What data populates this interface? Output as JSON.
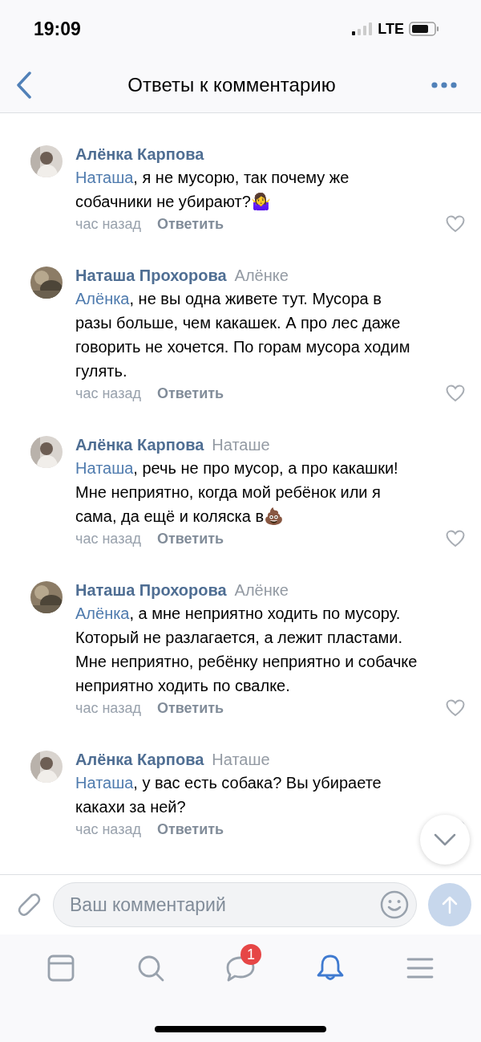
{
  "status_bar": {
    "time": "19:09",
    "network": "LTE"
  },
  "header": {
    "title": "Ответы к комментарию"
  },
  "comments": [
    {
      "author": "Алёнка Карпова",
      "mention": "Наташа",
      "text": ", я не мусорю, так почему же собачники не убирают?",
      "emoji": "🤷‍♀️",
      "time": "час назад",
      "reply": "Ответить"
    },
    {
      "author": "Наташа Прохорова",
      "reply_to": "Алёнке",
      "mention": "Алёнка",
      "text": ", не вы одна живете тут. Мусора в разы больше, чем какашек. А про лес даже говорить не хочется. По горам мусора ходим гулять.",
      "time": "час назад",
      "reply": "Ответить"
    },
    {
      "author": "Алёнка Карпова",
      "reply_to": "Наташе",
      "mention": "Наташа",
      "text": ", речь не про мусор, а про какашки! Мне неприятно,  когда мой ребёнок или я сама, да ещё и коляска в",
      "emoji": "💩",
      "time": "час назад",
      "reply": "Ответить"
    },
    {
      "author": "Наташа Прохорова",
      "reply_to": "Алёнке",
      "mention": "Алёнка",
      "text": ", а мне неприятно ходить по мусору. Который не разлагается, а лежит пластами. Мне неприятно, ребёнку неприятно и собачке неприятно ходить по свалке.",
      "time": "час назад",
      "reply": "Ответить"
    },
    {
      "author": "Алёнка Карпова",
      "reply_to": "Наташе",
      "mention": "Наташа",
      "text": ", у вас есть собака? Вы убираете какахи за ней?",
      "time": "час назад",
      "reply": "Ответить"
    }
  ],
  "composer": {
    "placeholder": "Ваш комментарий"
  },
  "tabs": [
    {
      "kind": "feed",
      "selected": false
    },
    {
      "kind": "search",
      "selected": false
    },
    {
      "kind": "messages",
      "selected": false,
      "badge": "1"
    },
    {
      "kind": "notifications",
      "selected": true
    },
    {
      "kind": "menu",
      "selected": false
    }
  ]
}
